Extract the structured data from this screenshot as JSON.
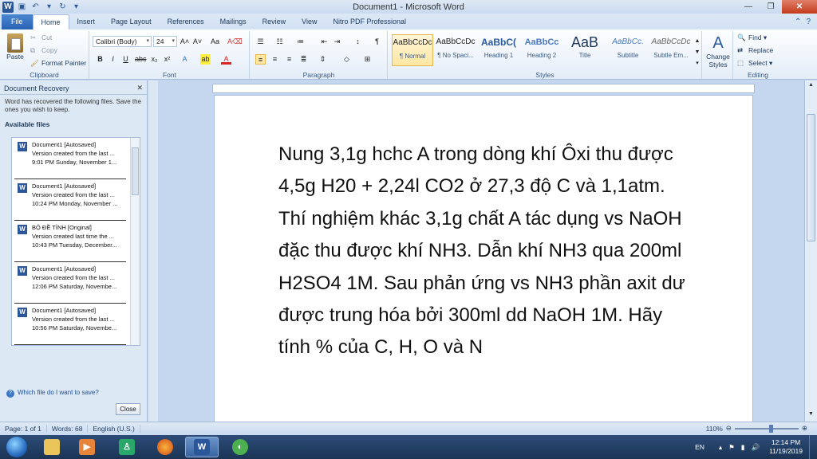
{
  "window": {
    "title": "Document1 - Microsoft Word"
  },
  "tabs": [
    "File",
    "Home",
    "Insert",
    "Page Layout",
    "References",
    "Mailings",
    "Review",
    "View",
    "Nitro PDF Professional"
  ],
  "clipboard": {
    "paste": "Paste",
    "cut": "Cut",
    "copy": "Copy",
    "format_painter": "Format Painter",
    "label": "Clipboard"
  },
  "font": {
    "name": "Calibri (Body)",
    "size": "24",
    "label": "Font"
  },
  "paragraph": {
    "label": "Paragraph"
  },
  "styles": {
    "label": "Styles",
    "items": [
      {
        "sample": "AaBbCcDc",
        "name": "¶ Normal"
      },
      {
        "sample": "AaBbCcDc",
        "name": "¶ No Spaci..."
      },
      {
        "sample": "AaBbC(",
        "name": "Heading 1"
      },
      {
        "sample": "AaBbCc",
        "name": "Heading 2"
      },
      {
        "sample": "AaB",
        "name": "Title"
      },
      {
        "sample": "AaBbCc.",
        "name": "Subtitle"
      },
      {
        "sample": "AaBbCcDc",
        "name": "Subtle Em..."
      }
    ],
    "change_styles": "Change Styles"
  },
  "editing": {
    "find": "Find",
    "replace": "Replace",
    "select": "Select",
    "label": "Editing"
  },
  "recovery_pane": {
    "title": "Document Recovery",
    "description": "Word has recovered the following files.  Save the ones you wish to keep.",
    "available_files": "Available files",
    "files": [
      {
        "name": "Document1  [Autosaved]",
        "line1": "Version created from the last ...",
        "line2": "9:01 PM Sunday, November 1..."
      },
      {
        "name": "Document1  [Autosaved]",
        "line1": "Version created from the last ...",
        "line2": "10:24 PM Monday, November ..."
      },
      {
        "name": "BỘ ĐỀ TỈNH  [Original]",
        "line1": "Version created last time the ...",
        "line2": "10:43 PM Tuesday, December..."
      },
      {
        "name": "Document1  [Autosaved]",
        "line1": "Version created from the last ...",
        "line2": "12:06 PM Saturday, Novembe..."
      },
      {
        "name": "Document1  [Autosaved]",
        "line1": "Version created from the last ...",
        "line2": "10:56 PM Saturday, Novembe..."
      }
    ],
    "help_link": "Which file do I want to save?",
    "close_button": "Close"
  },
  "document": {
    "text": "Nung 3,1g hchc A trong dòng khí Ôxi thu được 4,5g H20 + 2,24l CO2 ở 27,3 độ C và 1,1atm. Thí nghiệm khác 3,1g chất A tác dụng vs NaOH đặc thu được khí NH3. Dẫn khí NH3 qua 200ml H2SO4 1M. Sau phản ứng vs NH3 phần axit dư được trung hóa bởi 300ml dd NaOH 1M. Hãy tính % của C, H, O và N"
  },
  "status_bar": {
    "page": "Page: 1 of 1",
    "words": "Words: 68",
    "language": "English (U.S.)",
    "zoom": "110%",
    "zoom_fraction": 0.55
  },
  "taskbar": {
    "lang": "EN",
    "time": "12:14 PM",
    "date": "11/19/2019"
  }
}
